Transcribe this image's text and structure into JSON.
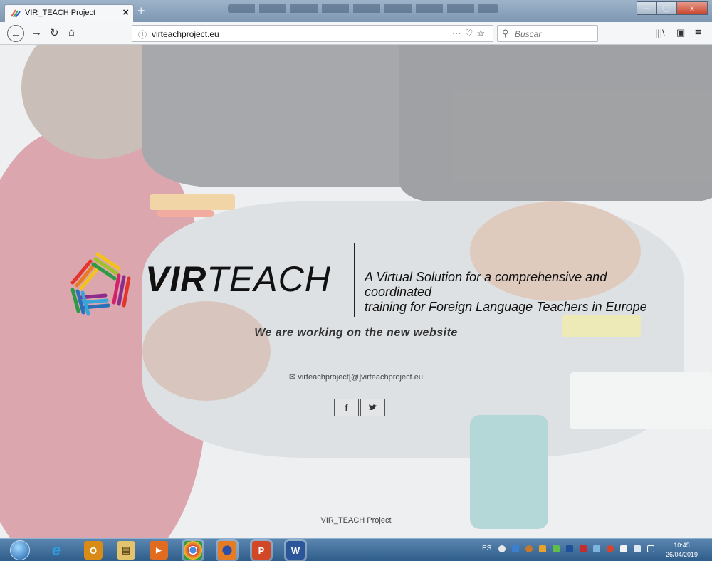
{
  "browser": {
    "tab_title": "VIR_TEACH Project",
    "new_tab_label": "+",
    "address": "virteachproject.eu",
    "search_placeholder": "Buscar",
    "min_label": "–",
    "max_label": "▢",
    "close_label": "x"
  },
  "page": {
    "logo_bold": "VIR",
    "logo_light": "TEACH",
    "tagline_line1": "A Virtual Solution for a comprehensive and coordinated",
    "tagline_line2": "training for Foreign Language Teachers in Europe",
    "headline": "We are working on the new website",
    "email": "virteachproject[@]virteachproject.eu",
    "facebook_label": "f",
    "twitter_label": "🐦",
    "footer": "VIR_TEACH Project"
  },
  "taskbar": {
    "apps": [
      {
        "name": "Internet Explorer",
        "glyph": "e",
        "color": "#2f9bdc"
      },
      {
        "name": "Outlook",
        "glyph": "O",
        "color": "#d98b17"
      },
      {
        "name": "Explorer",
        "glyph": "▤",
        "color": "#e3c36b"
      },
      {
        "name": "Media Player",
        "glyph": "▶",
        "color": "#e16b1f"
      },
      {
        "name": "Chrome",
        "glyph": "◉",
        "color": "#d9442f"
      },
      {
        "name": "Firefox",
        "glyph": "🦊",
        "color": "#e57b22"
      },
      {
        "name": "PowerPoint",
        "glyph": "P",
        "color": "#d24726"
      },
      {
        "name": "Word",
        "glyph": "W",
        "color": "#2b579a"
      }
    ],
    "language": "ES",
    "time": "10:45",
    "date": "26/04/2019"
  }
}
